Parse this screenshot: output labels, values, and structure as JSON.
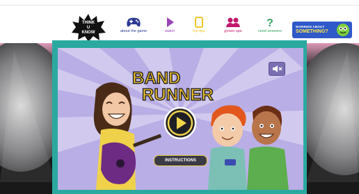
{
  "logo": {
    "text": "THINK U KNOW"
  },
  "nav": [
    {
      "label": "about the game",
      "icon": "gamepad-icon",
      "color": "#2d3a93"
    },
    {
      "label": "watch",
      "icon": "play-triangle-icon",
      "color": "#9a44b8"
    },
    {
      "label": "top tips",
      "icon": "phone-icon",
      "color": "#f0c629"
    },
    {
      "label": "grown ups",
      "icon": "people-icon",
      "color": "#c2186b"
    },
    {
      "label": "need answers",
      "icon": "question-mark-icon",
      "color": "#3aa364"
    }
  ],
  "worried": {
    "line1": "WORRIED ABOUT",
    "line2": "SOMETHING?",
    "color": "#2f59c8"
  },
  "game": {
    "title_line1": "BAND",
    "title_line2": "RUNNER",
    "instructions_label": "INSTRUCTIONS",
    "frame_color": "#2ba99f",
    "bg_color": "#b9aee5"
  }
}
